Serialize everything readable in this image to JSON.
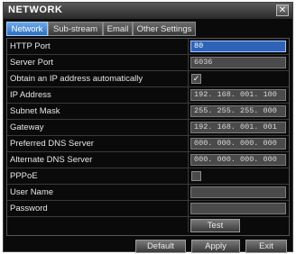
{
  "window": {
    "title": "NETWORK",
    "close_glyph": "✕"
  },
  "tabs": [
    {
      "label": "Network",
      "active": true
    },
    {
      "label": "Sub-stream",
      "active": false
    },
    {
      "label": "Email",
      "active": false
    },
    {
      "label": "Other Settings",
      "active": false
    }
  ],
  "rows": [
    {
      "label": "HTTP Port",
      "value": "80",
      "kind": "field-selected"
    },
    {
      "label": "Server Port",
      "value": "6036",
      "kind": "field"
    },
    {
      "label": "Obtain an IP address automatically",
      "value": "✓",
      "checked": true,
      "kind": "checkbox"
    },
    {
      "label": "IP Address",
      "value": "192. 168. 001. 100",
      "kind": "field"
    },
    {
      "label": "Subnet Mask",
      "value": "255. 255. 255. 000",
      "kind": "field"
    },
    {
      "label": "Gateway",
      "value": "192. 168. 001. 001",
      "kind": "field"
    },
    {
      "label": "Preferred DNS Server",
      "value": "000. 000. 000. 000",
      "kind": "field"
    },
    {
      "label": "Alternate DNS Server",
      "value": "000. 000. 000. 000",
      "kind": "field"
    },
    {
      "label": "PPPoE",
      "value": "",
      "checked": false,
      "kind": "checkbox"
    },
    {
      "label": "User Name",
      "value": "",
      "kind": "field"
    },
    {
      "label": "Password",
      "value": "",
      "kind": "field"
    }
  ],
  "test_button": "Test",
  "footer": {
    "default_label": "Default",
    "apply_label": "Apply",
    "exit_label": "Exit"
  },
  "colors": {
    "selected_tab": "#2f6fbf",
    "selected_field": "#2e63b8",
    "background": "#0a0a0a"
  }
}
